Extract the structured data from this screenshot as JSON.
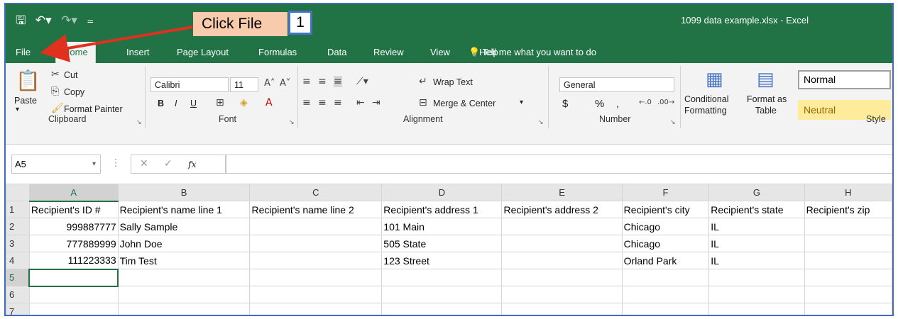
{
  "title_bar": {
    "qat_save_icon": "save-icon",
    "qat_undo_icon": "undo-icon",
    "qat_redo_icon": "redo-icon",
    "document_title": "1099 data example.xlsx - Excel"
  },
  "callout": {
    "text": "Click File",
    "step": "1"
  },
  "tabs": {
    "file": "File",
    "home": "Home",
    "insert": "Insert",
    "page_layout": "Page Layout",
    "formulas": "Formulas",
    "data": "Data",
    "review": "Review",
    "view": "View",
    "help": "Help",
    "tell_me": "Tell me what you want to do"
  },
  "ribbon": {
    "clipboard": {
      "paste": "Paste",
      "cut": "Cut",
      "copy": "Copy",
      "format_painter": "Format Painter",
      "label": "Clipboard"
    },
    "font": {
      "font_name": "Calibri",
      "font_size": "11",
      "bold": "B",
      "italic": "I",
      "underline": "U",
      "label": "Font"
    },
    "alignment": {
      "wrap_text": "Wrap Text",
      "merge_center": "Merge & Center",
      "label": "Alignment"
    },
    "number": {
      "format": "General",
      "currency": "$",
      "percent": "%",
      "comma": ",",
      "label": "Number"
    },
    "styles": {
      "conditional": "Conditional",
      "formatting": "Formatting",
      "format_as": "Format as",
      "table": "Table",
      "normal": "Normal",
      "neutral": "Neutral",
      "label": "Style"
    }
  },
  "formula_bar": {
    "name_box": "A5",
    "fx": "fx",
    "content": ""
  },
  "sheet": {
    "columns": [
      "A",
      "B",
      "C",
      "D",
      "E",
      "F",
      "G",
      "H"
    ],
    "rows": [
      {
        "num": "1",
        "cells": [
          "Recipient's ID #",
          "Recipient's name line 1",
          "Recipient's name line 2",
          "Recipient's address 1",
          "Recipient's address 2",
          "Recipient's city",
          "Recipient's state",
          "Recipient's zip"
        ]
      },
      {
        "num": "2",
        "cells": [
          "999887777",
          "Sally Sample",
          "",
          "101 Main",
          "",
          "Chicago",
          "IL",
          ""
        ]
      },
      {
        "num": "3",
        "cells": [
          "777889999",
          "John Doe",
          "",
          "505 State",
          "",
          "Chicago",
          "IL",
          ""
        ]
      },
      {
        "num": "4",
        "cells": [
          "111223333",
          "Tim Test",
          "",
          "123 Street",
          "",
          "Orland Park",
          "IL",
          ""
        ]
      },
      {
        "num": "5",
        "cells": [
          "",
          "",
          "",
          "",
          "",
          "",
          "",
          ""
        ]
      },
      {
        "num": "6",
        "cells": [
          "",
          "",
          "",
          "",
          "",
          "",
          "",
          ""
        ]
      },
      {
        "num": "7",
        "cells": [
          "",
          "",
          "",
          "",
          "",
          "",
          "",
          ""
        ]
      }
    ],
    "active_cell": "A5"
  },
  "colors": {
    "excel_green": "#217346",
    "callout_fill": "#f8cbad",
    "callout_border": "#4472c4",
    "arrow": "#e0301e",
    "neutral_fill": "#ffeb9c"
  }
}
